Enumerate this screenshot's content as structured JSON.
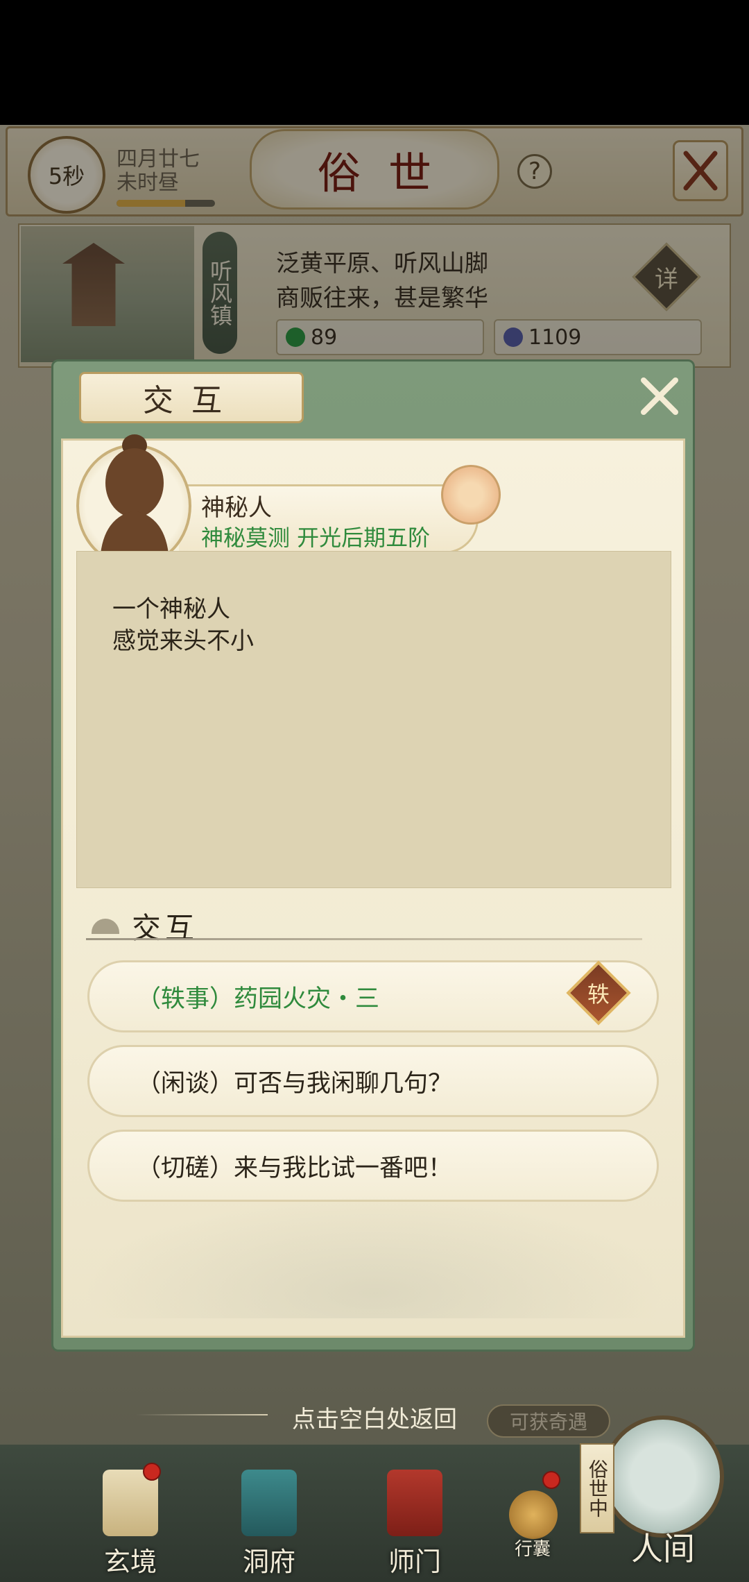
{
  "header": {
    "timer": "5秒",
    "date": "四月廿七",
    "period": "未时昼",
    "day_progress": 0.7,
    "title": "俗世",
    "help": "?"
  },
  "location": {
    "name": "听风镇",
    "desc_line1": "泛黄平原、听风山脚",
    "desc_line2": "商贩往来，甚是繁华",
    "detail_label": "详",
    "res_spirit": "89",
    "res_coin": "1109"
  },
  "dialog": {
    "title": "交互",
    "npc_name": "神秘人",
    "npc_rank": "神秘莫测 开光后期五阶",
    "desc_line1": "一个神秘人",
    "desc_line2": "感觉来头不小",
    "section_title": "交互",
    "options": [
      {
        "label": "（轶事）药园火灾・三",
        "badge": "轶"
      },
      {
        "label": "（闲谈）可否与我闲聊几句？"
      },
      {
        "label": "（切磋）来与我比试一番吧！"
      }
    ],
    "return_hint": "点击空白处返回",
    "chance_label": "可获奇遇"
  },
  "nav": {
    "items": [
      {
        "label": "玄境"
      },
      {
        "label": "洞府"
      },
      {
        "label": "师门"
      },
      {
        "label": "行囊"
      }
    ],
    "world_tag": "俗世中",
    "world_label": "人间"
  },
  "colors": {
    "accent_green": "#2f8a3c",
    "title_red": "#7a1f14",
    "modal_green": "#7e9a7b"
  }
}
